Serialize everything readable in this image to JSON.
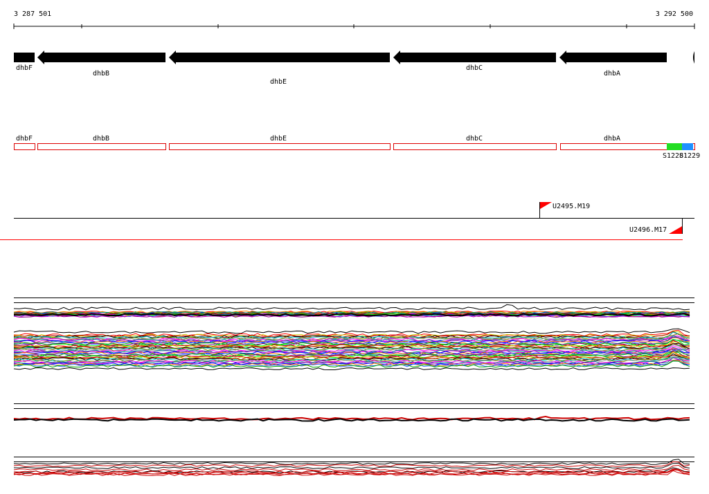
{
  "ruler": {
    "start_label": "3 287 501",
    "end_label": "3 292 500"
  },
  "genes": [
    {
      "name": "dhbF",
      "strand": "-"
    },
    {
      "name": "dhbB",
      "strand": "-"
    },
    {
      "name": "dhbE",
      "strand": "-"
    },
    {
      "name": "dhbC",
      "strand": "-"
    },
    {
      "name": "dhbA",
      "strand": "-"
    }
  ],
  "annotation_track": {
    "features": [
      "dhbF",
      "dhbB",
      "dhbE",
      "dhbC",
      "dhbA"
    ],
    "segments": [
      {
        "label": "S1228",
        "color": "#22dd22"
      },
      {
        "label": "S1229",
        "color": "#1e90ff"
      }
    ]
  },
  "markers": [
    {
      "label": "U2495.M19",
      "color": "#ff0000"
    },
    {
      "label": "U2496.M17",
      "color": "#ff0000"
    }
  ],
  "colors": {
    "gene": "#000000",
    "feature_outline": "#dd0000",
    "marker": "#ff0000"
  }
}
